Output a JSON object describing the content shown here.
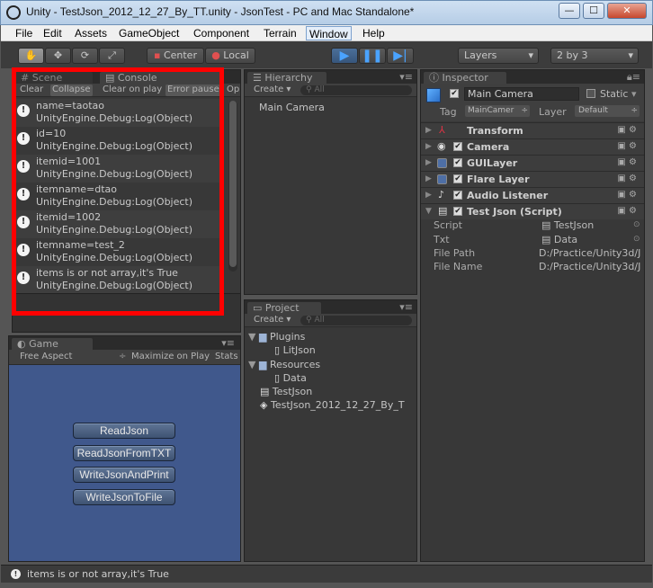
{
  "window": {
    "title": "Unity - TestJson_2012_12_27_By_TT.unity - JsonTest - PC and Mac Standalone*",
    "minimize": "—",
    "maximize": "☐",
    "close": "✕"
  },
  "menu": [
    "File",
    "Edit",
    "Assets",
    "GameObject",
    "Component",
    "Terrain",
    "Window",
    "Help"
  ],
  "toolbar": {
    "center": "Center",
    "local": "Local",
    "layers": "Layers",
    "layout": "2 by 3"
  },
  "scene_tab": "Scene",
  "console": {
    "tab": "Console",
    "buttons": [
      "Clear",
      "Collapse",
      "Clear on play",
      "Error pause",
      "Op"
    ],
    "entries": [
      {
        "line1": "name=taotao",
        "line2": "UnityEngine.Debug:Log(Object)"
      },
      {
        "line1": "id=10",
        "line2": "UnityEngine.Debug:Log(Object)"
      },
      {
        "line1": "itemid=1001",
        "line2": "UnityEngine.Debug:Log(Object)"
      },
      {
        "line1": "itemname=dtao",
        "line2": "UnityEngine.Debug:Log(Object)"
      },
      {
        "line1": "itemid=1002",
        "line2": "UnityEngine.Debug:Log(Object)"
      },
      {
        "line1": "itemname=test_2",
        "line2": "UnityEngine.Debug:Log(Object)"
      },
      {
        "line1": "items is or not array,it's True",
        "line2": "UnityEngine.Debug:Log(Object)"
      }
    ]
  },
  "game": {
    "tab": "Game",
    "aspect": "Free Aspect",
    "maximize": "Maximize on Play",
    "stats": "Stats",
    "buttons": [
      "ReadJson",
      "ReadJsonFromTXT",
      "WriteJsonAndPrint",
      "WriteJsonToFile"
    ]
  },
  "hierarchy": {
    "tab": "Hierarchy",
    "create": "Create",
    "search_placeholder": "All",
    "items": [
      "Main Camera"
    ]
  },
  "project": {
    "tab": "Project",
    "create": "Create",
    "search_placeholder": "All",
    "items": [
      "Plugins",
      "LitJson",
      "Resources",
      "Data",
      "TestJson",
      "TestJson_2012_12_27_By_T"
    ]
  },
  "inspector": {
    "tab": "Inspector",
    "object_name": "Main Camera",
    "static": "Static",
    "tag_label": "Tag",
    "tag_value": "MainCamer",
    "layer_label": "Layer",
    "layer_value": "Default",
    "components": [
      "Transform",
      "Camera",
      "GUILayer",
      "Flare Layer",
      "Audio Listener",
      "Test Json (Script)"
    ],
    "fields": [
      {
        "label": "Script",
        "value": "TestJson"
      },
      {
        "label": "Txt",
        "value": "Data"
      },
      {
        "label": "File Path",
        "value": "D:/Practice/Unity3d/J"
      },
      {
        "label": "File Name",
        "value": "D:/Practice/Unity3d/J"
      }
    ]
  },
  "status_bar": "items is or not array,it's True"
}
